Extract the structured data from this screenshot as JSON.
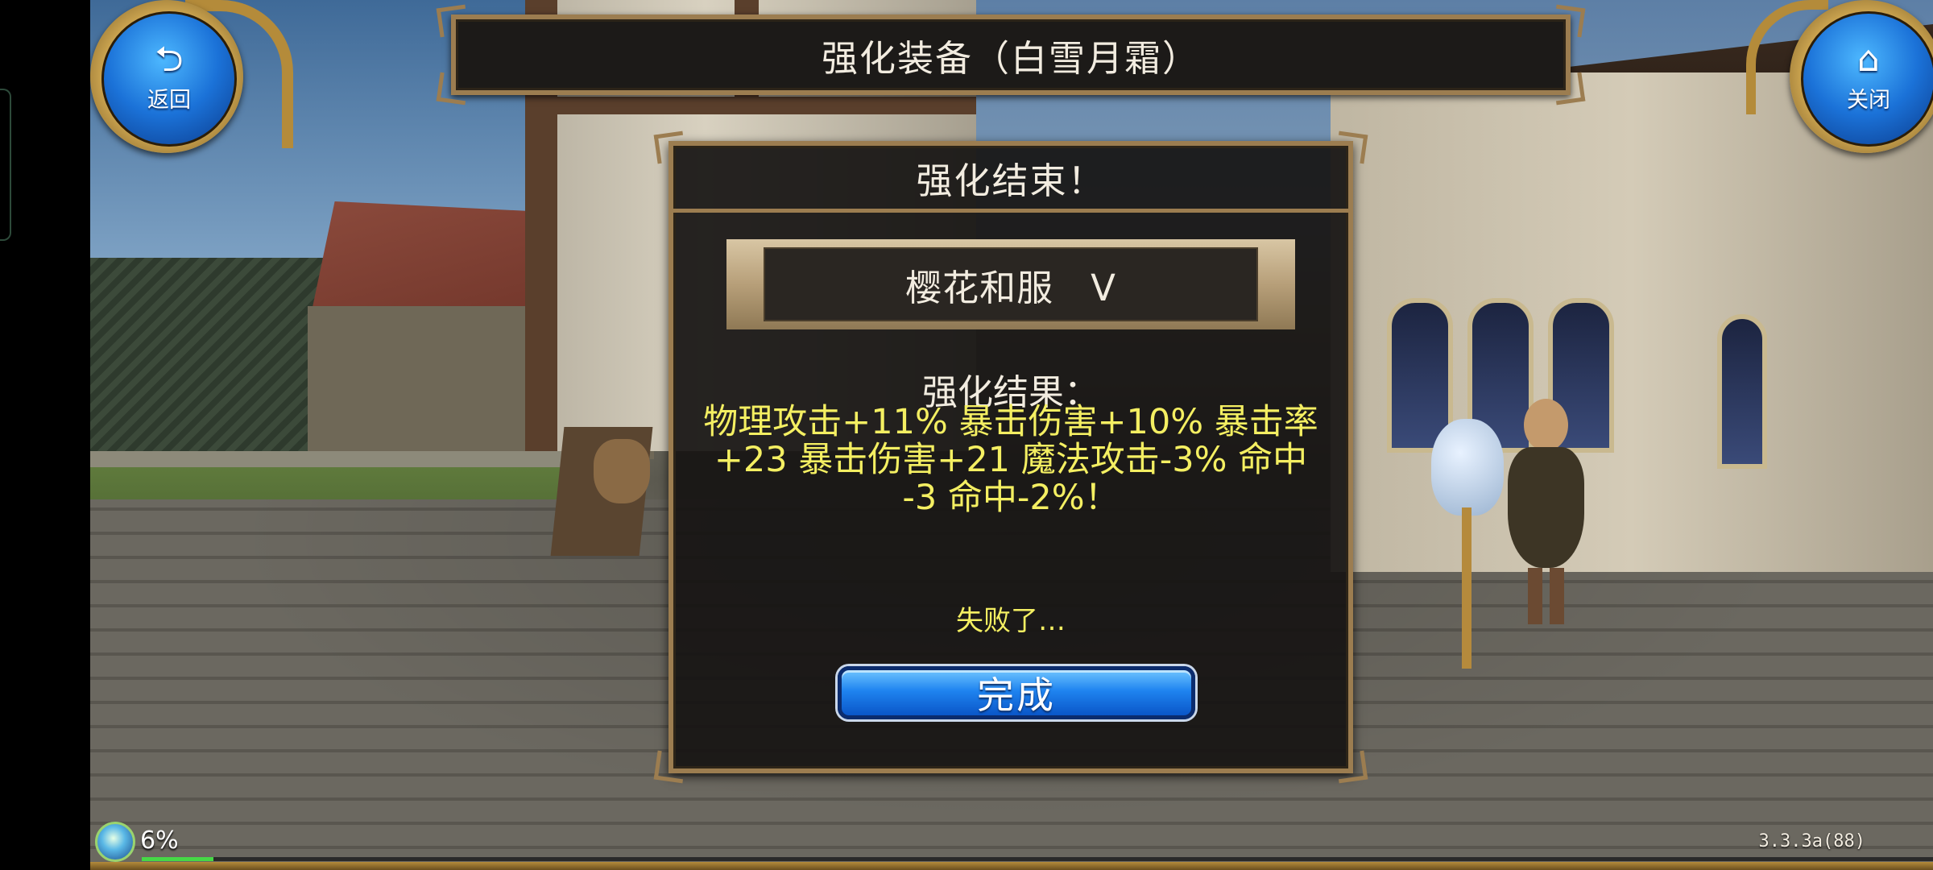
{
  "top_left_button": {
    "label": "返回",
    "icon": "back-arrow-icon"
  },
  "top_right_button": {
    "label": "关闭",
    "icon": "home-icon"
  },
  "title_bar": {
    "title": "强化装备（白雪月霜）"
  },
  "dialog": {
    "header": "强化结束！",
    "item_name": "樱花和服　V",
    "result_heading": "强化结果：",
    "result_lines": [
      "物理攻击+11% 暴击伤害+10% 暴击率",
      "+23 暴击伤害+21 魔法攻击-3% 命中",
      "-3 命中-2%！"
    ],
    "status": "失败了…",
    "done_button": "完成"
  },
  "hud": {
    "exp_percent_text": "6%",
    "exp_fraction": 0.04,
    "version": "3.3.3a(88)"
  },
  "colors": {
    "highlight_text": "#f4ef62",
    "frame_gold": "#9c7d50",
    "button_blue": "#1f84f0"
  }
}
